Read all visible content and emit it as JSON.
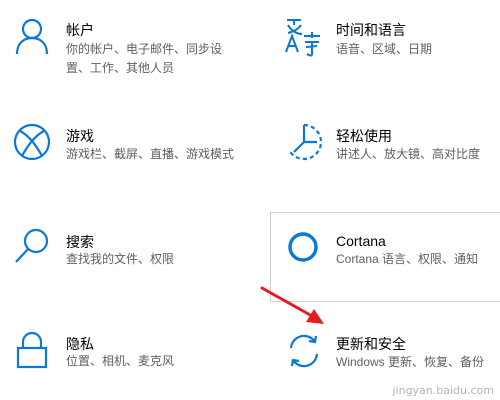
{
  "colors": {
    "accent": "#0a78d4",
    "title": "#000000",
    "desc": "#5f5f5f",
    "arrow": "#e51c1c",
    "tile_border": "#cfcfcf"
  },
  "tiles": [
    {
      "id": "accounts",
      "icon": "person-icon",
      "title": "帐户",
      "desc": "你的帐户、电子邮件、同步设置、工作、其他人员"
    },
    {
      "id": "time-language",
      "icon": "language-icon",
      "title": "时间和语言",
      "desc": "语音、区域、日期"
    },
    {
      "id": "gaming",
      "icon": "xbox-icon",
      "title": "游戏",
      "desc": "游戏栏、截屏、直播、游戏模式"
    },
    {
      "id": "ease-of-access",
      "icon": "ease-of-access-icon",
      "title": "轻松使用",
      "desc": "讲述人、放大镜、高对比度"
    },
    {
      "id": "search",
      "icon": "search-icon",
      "title": "搜索",
      "desc": "查找我的文件、权限"
    },
    {
      "id": "cortana",
      "icon": "cortana-icon",
      "title": "Cortana",
      "desc": "Cortana 语言、权限、通知"
    },
    {
      "id": "privacy",
      "icon": "lock-icon",
      "title": "隐私",
      "desc": "位置、相机、麦克风"
    },
    {
      "id": "update-security",
      "icon": "sync-icon",
      "title": "更新和安全",
      "desc": "Windows 更新、恢复、备份"
    }
  ],
  "watermark": "jingyan.baidu.com"
}
